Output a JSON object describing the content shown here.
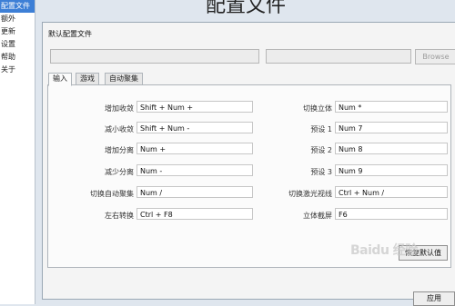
{
  "page_title": "配置文件",
  "sidebar": {
    "items": [
      {
        "label": "配置文件"
      },
      {
        "label": "额外"
      },
      {
        "label": "更新"
      },
      {
        "label": "设置"
      },
      {
        "label": "帮助"
      },
      {
        "label": "关于"
      }
    ]
  },
  "panel": {
    "title": "默认配置文件",
    "browse_label": "Browse",
    "tabs": [
      {
        "label": "输入"
      },
      {
        "label": "游戏"
      },
      {
        "label": "自动聚集"
      }
    ],
    "fields_left": [
      {
        "label": "增加收敛",
        "value": "Shift + Num +"
      },
      {
        "label": "减小收敛",
        "value": "Shift + Num -"
      },
      {
        "label": "增加分离",
        "value": "Num +"
      },
      {
        "label": "减少分离",
        "value": "Num -"
      },
      {
        "label": "切换自动聚集",
        "value": "Num /"
      },
      {
        "label": "左右转换",
        "value": "Ctrl + F8"
      }
    ],
    "fields_right": [
      {
        "label": "切换立体",
        "value": "Num *"
      },
      {
        "label": "预设 1",
        "value": "Num 7"
      },
      {
        "label": "预设 2",
        "value": "Num 8"
      },
      {
        "label": "预设 3",
        "value": "Num 9"
      },
      {
        "label": "切换激光视线",
        "value": "Ctrl + Num /"
      },
      {
        "label": "立体截屏",
        "value": "F6"
      }
    ],
    "reset_label": "恢复默认值",
    "apply_label": "应用"
  },
  "watermark": {
    "text": "Baidu 经验"
  }
}
